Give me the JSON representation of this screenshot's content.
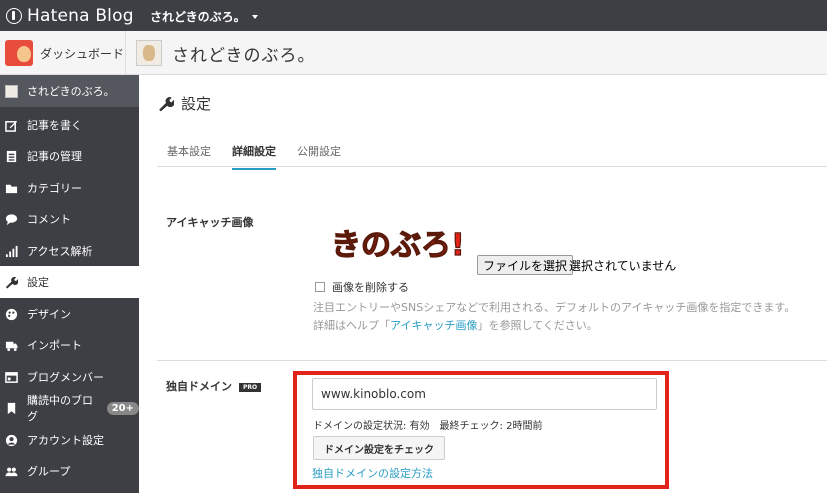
{
  "topbar": {
    "brand": "Hatena Blog",
    "blog_switch": "されどきのぶろ。"
  },
  "subheader": {
    "dashboard": "ダッシュボード",
    "blog_title": "されどきのぶろ。"
  },
  "sidebar": {
    "items": [
      {
        "label": "されどきのぶろ。",
        "icon": "blog-avatar"
      },
      {
        "label": "記事を書く",
        "icon": "edit-icon"
      },
      {
        "label": "記事の管理",
        "icon": "document-icon"
      },
      {
        "label": "カテゴリー",
        "icon": "folder-icon"
      },
      {
        "label": "コメント",
        "icon": "comment-icon"
      },
      {
        "label": "アクセス解析",
        "icon": "chart-icon"
      },
      {
        "label": "設定",
        "icon": "wrench-icon"
      },
      {
        "label": "デザイン",
        "icon": "palette-icon"
      },
      {
        "label": "インポート",
        "icon": "truck-icon"
      },
      {
        "label": "ブログメンバー",
        "icon": "members-icon"
      },
      {
        "label": "購読中のブログ",
        "icon": "bookmark-icon",
        "badge": "20+"
      },
      {
        "label": "アカウント設定",
        "icon": "account-icon"
      },
      {
        "label": "グループ",
        "icon": "group-icon"
      }
    ]
  },
  "main": {
    "title": "設定",
    "tabs": [
      {
        "label": "基本設定"
      },
      {
        "label": "詳細設定"
      },
      {
        "label": "公開設定"
      }
    ],
    "eyecatch": {
      "label": "アイキャッチ画像",
      "image_text": "きのぶろ!",
      "file_button": "ファイルを選択",
      "file_status": "選択されていません",
      "delete_label": "画像を削除する",
      "help_line1": "注目エントリーやSNSシェアなどで利用される、デフォルトのアイキャッチ画像を指定できます。",
      "help_line2_pre": "詳細はヘルプ「",
      "help_link": "アイキャッチ画像",
      "help_line2_post": "」を参照してください。"
    },
    "domain": {
      "label": "独自ドメイン",
      "badge": "PRO",
      "value": "www.kinoblo.com",
      "status": "ドメインの設定状況: 有効　最終チェック: 2時間前",
      "check_button": "ドメイン設定をチェック",
      "howto_link": "独自ドメインの設定方法"
    }
  },
  "colors": {
    "sidebar_bg": "#3d3f44",
    "accent": "#2a9dc4",
    "highlight": "#e2231a"
  }
}
